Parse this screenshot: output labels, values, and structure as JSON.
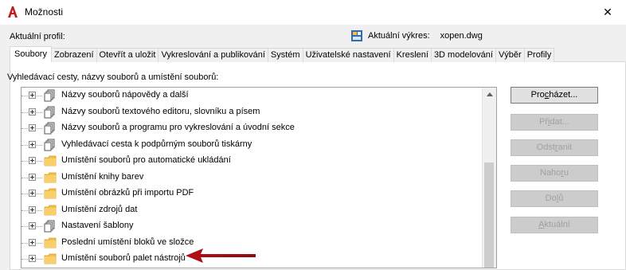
{
  "window": {
    "title": "Možnosti",
    "close_glyph": "✕"
  },
  "profile": {
    "label": "Aktuální profil:"
  },
  "drawing": {
    "label": "Aktuální výkres:",
    "value": "xopen.dwg"
  },
  "tabs": [
    {
      "label": "Soubory",
      "active": true
    },
    {
      "label": "Zobrazení"
    },
    {
      "label": "Otevřít a uložit"
    },
    {
      "label": "Vykreslování a publikování"
    },
    {
      "label": "Systém"
    },
    {
      "label": "Uživatelské nastavení"
    },
    {
      "label": "Kreslení"
    },
    {
      "label": "3D modelování"
    },
    {
      "label": "Výběr"
    },
    {
      "label": "Profily"
    }
  ],
  "paths_label": "Vyhledávací cesty, názvy souborů a umístění souborů:",
  "tree": {
    "items": [
      {
        "label": "Názvy souborů nápovědy a další",
        "icon": "files-icon"
      },
      {
        "label": "Názvy souborů textového editoru, slovníku a písem",
        "icon": "files-icon"
      },
      {
        "label": "Názvy souborů a programu pro vykreslování a úvodní sekce",
        "icon": "files-icon"
      },
      {
        "label": "Vyhledávací cesta k podpůrným souborů tiskárny",
        "icon": "files-icon"
      },
      {
        "label": "Umístění souborů pro automatické ukládání",
        "icon": "folder-icon"
      },
      {
        "label": "Umístění knihy barev",
        "icon": "folder-icon"
      },
      {
        "label": "Umístění obrázků při importu PDF",
        "icon": "folder-icon"
      },
      {
        "label": "Umístění zdrojů dat",
        "icon": "folder-icon"
      },
      {
        "label": "Nastavení šablony",
        "icon": "files-icon"
      },
      {
        "label": "Poslední umístění bloků ve složce",
        "icon": "folder-icon"
      },
      {
        "label": "Umístění souborů palet nástrojů",
        "icon": "folder-icon"
      }
    ]
  },
  "buttons": {
    "browse": {
      "pre": "Pro",
      "ul": "c",
      "post": "házet..."
    },
    "add": {
      "pre": "Př",
      "ul": "i",
      "post": "dat..."
    },
    "remove": {
      "pre": "Odst",
      "ul": "r",
      "post": "anit"
    },
    "up": {
      "pre": "Naho",
      "ul": "r",
      "post": "u"
    },
    "down": {
      "pre": "Do",
      "ul": "l",
      "post": "ů"
    },
    "current": {
      "pre": "",
      "ul": "A",
      "post": "ktuální"
    }
  },
  "colors": {
    "accent_red": "#c8171e",
    "folder_yellow": "#f5c04a",
    "arrow_red": "#b50f16"
  }
}
